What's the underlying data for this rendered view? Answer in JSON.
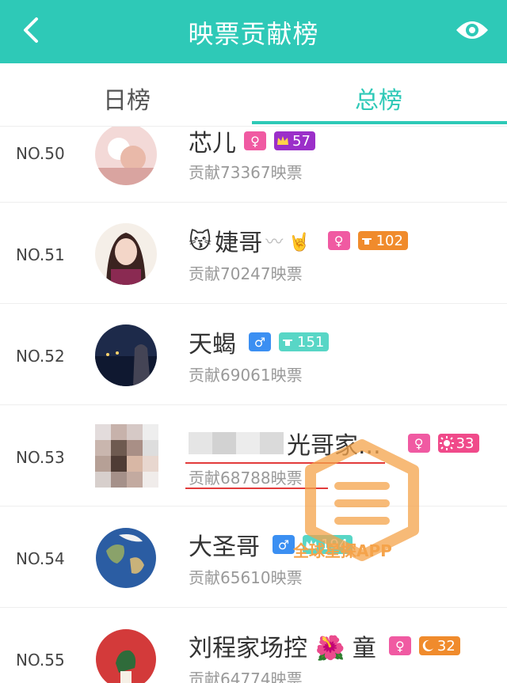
{
  "header": {
    "title": "映票贡献榜"
  },
  "tabs": [
    {
      "label": "日榜"
    },
    {
      "label": "总榜"
    }
  ],
  "rows": [
    {
      "rank": "NO.50",
      "name": "芯儿",
      "gender": "female",
      "level": "57",
      "level_color": "#9b2fc9",
      "contribution": "贡献73367映票"
    },
    {
      "rank": "NO.51",
      "name": "婕哥",
      "name_prefix_emoji": "😽",
      "name_suffix": "〰 🤘",
      "gender": "female",
      "level": "102",
      "level_color": "#f08b2c",
      "contribution": "贡献70247映票"
    },
    {
      "rank": "NO.52",
      "name": "天蝎",
      "gender": "male",
      "level": "151",
      "level_color": "#58d6c6",
      "contribution": "贡献69061映票"
    },
    {
      "rank": "NO.53",
      "name": "光哥家...",
      "gender": "female",
      "level": "33",
      "level_color": "#f04a8a",
      "contribution": "贡献68788映票"
    },
    {
      "rank": "NO.54",
      "name": "大圣哥",
      "gender": "male",
      "level": "194",
      "level_color": "#58d6c6",
      "contribution": "贡献65610映票"
    },
    {
      "rank": "NO.55",
      "name": "刘程家场控",
      "name_suffix": "🌺 童",
      "gender": "female",
      "level": "32",
      "level_color": "#f08b2c",
      "contribution": "贡献64774映票"
    }
  ],
  "watermark": {
    "text": "全球星探APP"
  },
  "colors": {
    "accent": "#2ec9b7",
    "female": "#f05aa2",
    "male": "#3b8ff2"
  }
}
